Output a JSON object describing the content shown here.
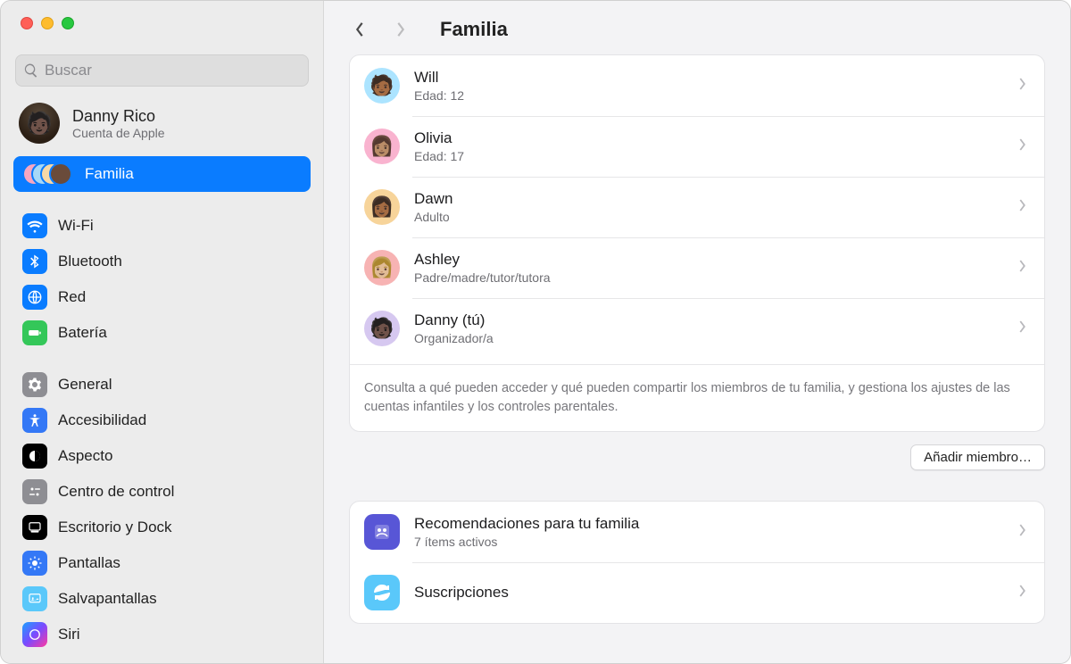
{
  "window": {
    "title": "Familia"
  },
  "search": {
    "placeholder": "Buscar"
  },
  "account": {
    "name": "Danny Rico",
    "subtitle": "Cuenta de Apple"
  },
  "sidebar": {
    "familia": "Familia",
    "wifi": "Wi-Fi",
    "bluetooth": "Bluetooth",
    "red": "Red",
    "bateria": "Batería",
    "general": "General",
    "accesibilidad": "Accesibilidad",
    "aspecto": "Aspecto",
    "centrocontrol": "Centro de control",
    "escritorio": "Escritorio y Dock",
    "pantallas": "Pantallas",
    "salvapantallas": "Salvapantallas",
    "siri": "Siri"
  },
  "members": [
    {
      "name": "Will",
      "sub": "Edad: 12",
      "avbg": "#ace4ff",
      "emoji": "🧑🏾"
    },
    {
      "name": "Olivia",
      "sub": "Edad: 17",
      "avbg": "#f9b3cf",
      "emoji": "👩🏽"
    },
    {
      "name": "Dawn",
      "sub": "Adulto",
      "avbg": "#f7d49a",
      "emoji": "👩🏾"
    },
    {
      "name": "Ashley",
      "sub": "Padre/madre/tutor/tutora",
      "avbg": "#f7b3b3",
      "emoji": "👩🏼"
    },
    {
      "name": "Danny (tú)",
      "sub": "Organizador/a",
      "avbg": "#d6c8f0",
      "emoji": "🧑🏿"
    }
  ],
  "note": "Consulta a qué pueden acceder y qué pueden compartir los miembros de tu familia, y gestiona los ajustes de las cuentas infantiles y los controles parentales.",
  "addButton": "Añadir miembro…",
  "recs": {
    "title": "Recomendaciones para tu familia",
    "sub": "7 ítems activos",
    "iconbg": "#5856d6"
  },
  "subs": {
    "title": "Suscripciones",
    "iconbg": "#5ac8fa"
  }
}
